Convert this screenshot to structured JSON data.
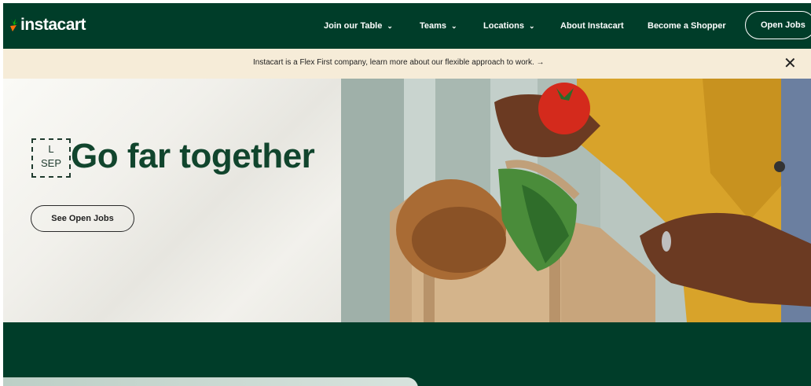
{
  "nav": {
    "logo_text": "instacart",
    "links": [
      {
        "label": "Join our Table",
        "has_dropdown": true
      },
      {
        "label": "Teams",
        "has_dropdown": true
      },
      {
        "label": "Locations",
        "has_dropdown": true
      },
      {
        "label": "About Instacart",
        "has_dropdown": false
      },
      {
        "label": "Become a Shopper",
        "has_dropdown": false
      }
    ],
    "cta_label": "Open Jobs",
    "chevron": "⌄"
  },
  "banner": {
    "text": "Instacart is a Flex First company, learn more about our flexible approach to work. →",
    "close_glyph": "✕"
  },
  "hero": {
    "sep_top": "L",
    "sep_bottom": "SEP",
    "headline": "Go far together",
    "button_label": "See Open Jobs"
  },
  "colors": {
    "brand_dark_green": "#003d29",
    "headline_green": "#11452d",
    "banner_bg": "#f6ecd8",
    "carrot_orange": "#ff7009",
    "leaf_green": "#0aad0a"
  },
  "icons": [
    "carrot-logo-icon",
    "chevron-down-icon",
    "arrow-right-icon",
    "close-icon"
  ]
}
